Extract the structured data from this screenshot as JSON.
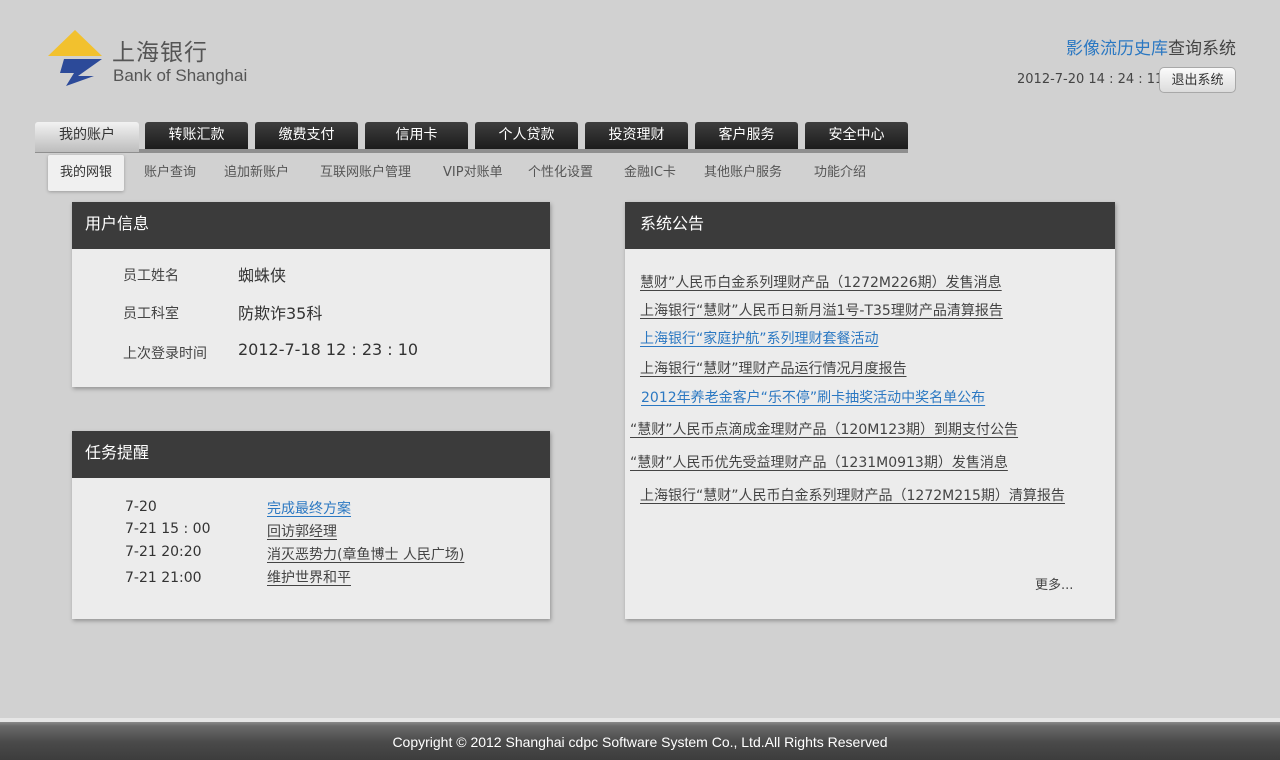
{
  "brand": {
    "name_cn": "上海银行",
    "name_en": "Bank of Shanghai",
    "logo_colors": {
      "yellow": "#f2c12e",
      "blue": "#2c4a99"
    }
  },
  "header": {
    "system_title_highlight": "影像流历史库",
    "system_title_rest": "查询系统",
    "datetime": "2012-7-20  14 : 24 : 11",
    "logout_label": "退出系统"
  },
  "nav": {
    "tabs": [
      {
        "label": "我的账户",
        "active": true
      },
      {
        "label": "转账汇款"
      },
      {
        "label": "缴费支付"
      },
      {
        "label": "信用卡"
      },
      {
        "label": "个人贷款"
      },
      {
        "label": "投资理财"
      },
      {
        "label": "客户服务"
      },
      {
        "label": "安全中心"
      }
    ]
  },
  "subnav": {
    "items": [
      {
        "label": "我的网银",
        "active": true
      },
      {
        "label": "账户查询"
      },
      {
        "label": "追加新账户"
      },
      {
        "label": "互联网账户管理"
      },
      {
        "label": "VIP对账单"
      },
      {
        "label": "个性化设置"
      },
      {
        "label": "金融IC卡"
      },
      {
        "label": "其他账户服务"
      },
      {
        "label": "功能介绍"
      }
    ]
  },
  "user_info": {
    "title": "用户信息",
    "rows": [
      {
        "label": "员工姓名",
        "value": "蜘蛛侠"
      },
      {
        "label": "员工科室",
        "value": "防欺诈35科"
      },
      {
        "label": "上次登录时间",
        "value": "2012-7-18 12 : 23 : 10"
      }
    ]
  },
  "tasks": {
    "title": "任务提醒",
    "items": [
      {
        "date": "7-20",
        "text": "完成最终方案",
        "highlight": true
      },
      {
        "date": "7-21   15 : 00",
        "text": "回访郭经理"
      },
      {
        "date": "7-21  20:20",
        "text": "消灭恶势力(章鱼博士 人民广场)"
      },
      {
        "date": "7-21   21:00",
        "text": "维护世界和平"
      }
    ]
  },
  "notices": {
    "title": "系统公告",
    "items": [
      {
        "text": "慧财”人民币白金系列理财产品（1272M226期）发售消息"
      },
      {
        "text": "上海银行“慧财”人民币日新月溢1号-T35理财产品清算报告"
      },
      {
        "text": "上海银行“家庭护航”系列理财套餐活动",
        "highlight": true
      },
      {
        "text": "上海银行“慧财”理财产品运行情况月度报告"
      },
      {
        "text": "2012年养老金客户“乐不停”刷卡抽奖活动中奖名单公布",
        "highlight": true
      },
      {
        "text": "“慧财”人民币点滴成金理财产品（120M123期）到期支付公告"
      },
      {
        "text": "“慧财”人民币优先受益理财产品（1231M0913期）发售消息"
      },
      {
        "text": "上海银行“慧财”人民币白金系列理财产品（1272M215期）清算报告"
      }
    ],
    "more_label": "更多..."
  },
  "footer": {
    "copyright": "Copyright  ©  2012 Shanghai cdpc Software System Co., Ltd.All Rights Reserved"
  }
}
